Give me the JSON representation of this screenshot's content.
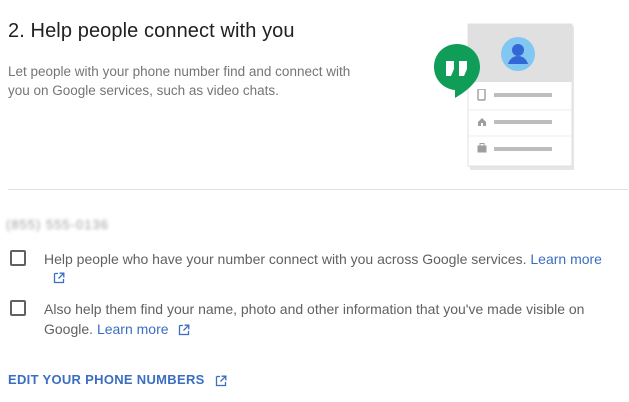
{
  "section": {
    "title": "2. Help people connect with you",
    "description": "Let people with your phone number find and connect with you on Google services, such as video chats."
  },
  "phone": {
    "number": "(855) 555-0136"
  },
  "options": [
    {
      "label": "Help people who have your number connect with you across Google services.",
      "link_label": "Learn more",
      "checked": false
    },
    {
      "label": "Also help them find your name, photo and other information that you've made visible on Google.",
      "link_label": "Learn more",
      "checked": false
    }
  ],
  "actions": {
    "edit_label": "EDIT YOUR PHONE NUMBERS"
  },
  "icons": {
    "chat": "hangouts-quote-icon",
    "avatar": "person-avatar-icon",
    "external": "open-in-new-icon",
    "phone": "phone-icon",
    "home": "home-icon",
    "work": "briefcase-icon"
  },
  "colors": {
    "link": "#3b6ec0",
    "hangouts_green": "#0f9d58",
    "avatar_blue": "#4285f4"
  }
}
